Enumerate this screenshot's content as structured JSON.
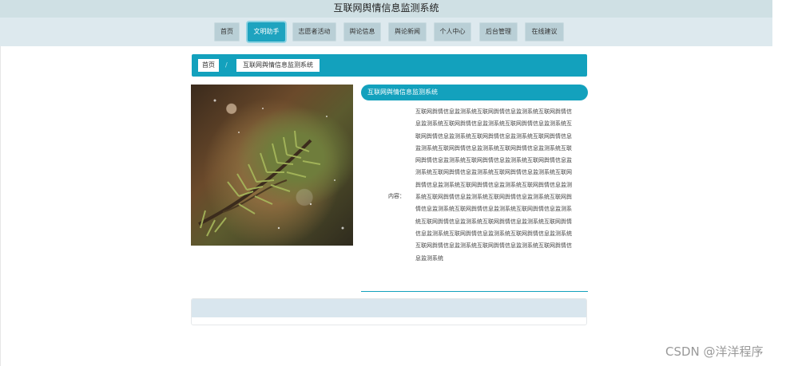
{
  "header": {
    "title": "互联网舆情信息监测系统"
  },
  "nav": {
    "items": [
      {
        "label": "首页"
      },
      {
        "label": "文明助手"
      },
      {
        "label": "志愿者活动"
      },
      {
        "label": "舆论信息"
      },
      {
        "label": "舆论新闻"
      },
      {
        "label": "个人中心"
      },
      {
        "label": "后台管理"
      },
      {
        "label": "在线建议"
      }
    ],
    "active": "文明助手"
  },
  "breadcrumb": {
    "home": "首页",
    "separator": "/",
    "current": "互联网舆情信息监测系统"
  },
  "detail": {
    "title": "互联网舆情信息监测系统",
    "content_label": "内容：",
    "content": "互联网舆情信息监测系统互联网舆情信息监测系统互联网舆情信息监测系统互联网舆情信息监测系统互联网舆情信息监测系统互联网舆情信息监测系统互联网舆情信息监测系统互联网舆情信息监测系统互联网舆情信息监测系统互联网舆情信息监测系统互联网舆情信息监测系统互联网舆情信息监测系统互联网舆情信息监测系统互联网舆情信息监测系统互联网舆情信息监测系统互联网舆情信息监测系统互联网舆情信息监测系统互联网舆情信息监测系统互联网舆情信息监测系统互联网舆情信息监测系统互联网舆情信息监测系统互联网舆情信息监测系统互联网舆情信息监测系统互联网舆情信息监测系统互联网舆情信息监测系统互联网舆情信息监测系统互联网舆情信息监测系统互联网舆情信息监测系统互联网舆情信息监测系统互联网舆情信息监测系统互联网舆情信息监测系统"
  },
  "watermark": "CSDN @洋洋程序",
  "colors": {
    "accent": "#13a1bd",
    "nav_bg": "#dde9ee",
    "nav_item": "#b9cfd6"
  }
}
